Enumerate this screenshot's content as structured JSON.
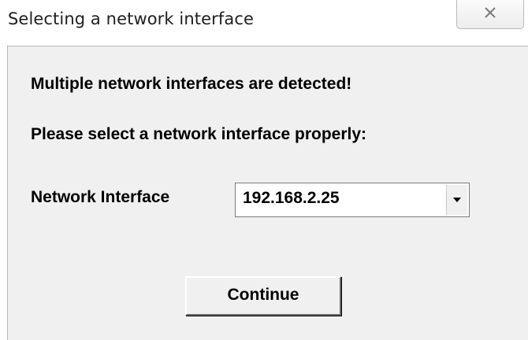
{
  "window": {
    "title": "Selecting a network interface",
    "close_icon": "close-x-icon"
  },
  "dialog": {
    "message_line1": "Multiple network interfaces are detected!",
    "message_line2": "Please select a network interface properly:",
    "field_label": "Network Interface",
    "selected_interface": "192.168.2.25",
    "dropdown_icon": "chevron-down-icon",
    "continue_label": "Continue"
  },
  "colors": {
    "client_background": "#f0f0f0",
    "title_background": "#ffffff",
    "text": "#000000"
  }
}
